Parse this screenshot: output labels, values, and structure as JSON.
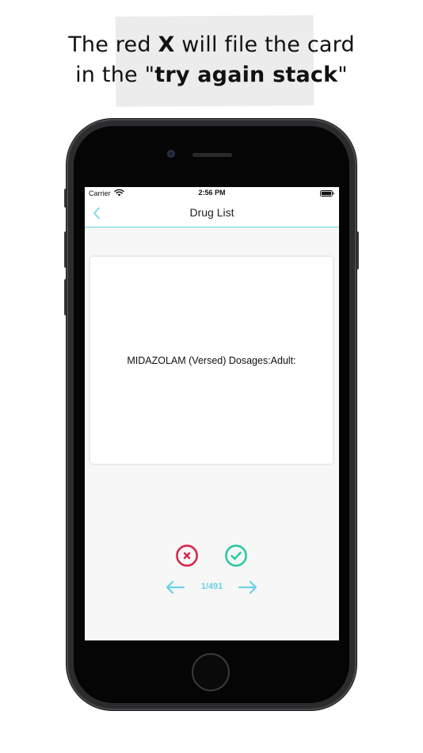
{
  "caption": {
    "line1_pre": "The red ",
    "line1_bold": "X",
    "line1_post": " will file the card",
    "line2_pre": "in the \"",
    "line2_bold": "try again stack",
    "line2_post": "\""
  },
  "status_bar": {
    "carrier": "Carrier",
    "time": "2:56 PM"
  },
  "nav": {
    "title": "Drug List",
    "back_icon": "chevron-left-icon"
  },
  "card": {
    "text": "MIDAZOLAM (Versed) Dosages:Adult:"
  },
  "controls": {
    "wrong_icon": "x-circle-icon",
    "right_icon": "check-circle-icon",
    "prev_icon": "arrow-left-icon",
    "next_icon": "arrow-right-icon",
    "page_count": "1/491"
  },
  "colors": {
    "accent": "#6bd1e4",
    "wrong": "#d6284f",
    "right": "#2ec9a0"
  }
}
